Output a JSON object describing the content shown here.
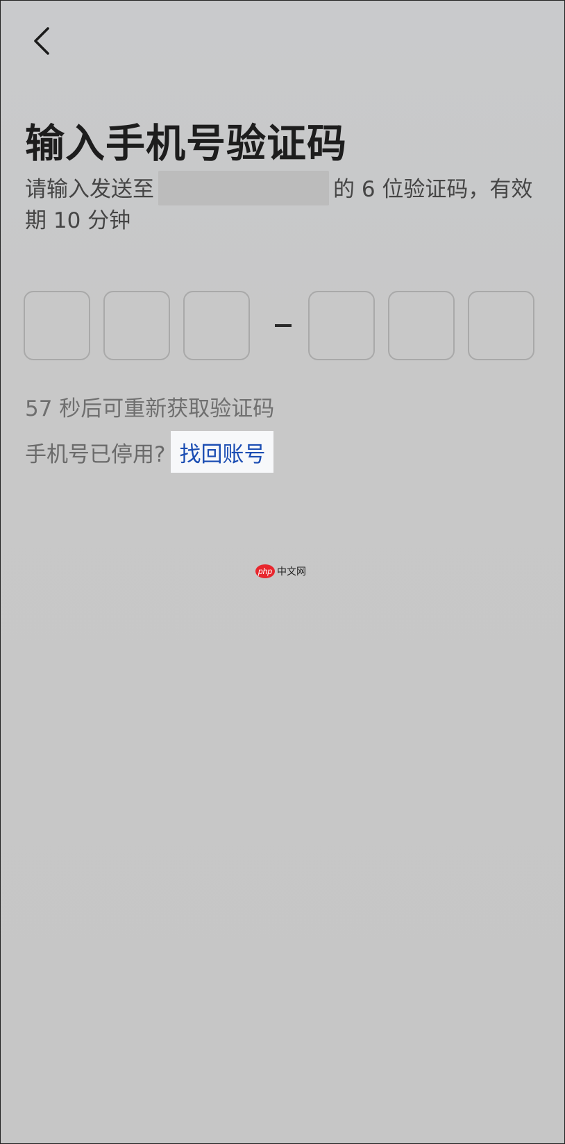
{
  "header": {
    "back_icon": "chevron-left-icon"
  },
  "title": "输入手机号验证码",
  "description": {
    "before_mask": "请输入发送至",
    "after_mask": "的 6 位验证码，有效期 10 分钟"
  },
  "code_input": {
    "digits": [
      "",
      "",
      "",
      "",
      "",
      ""
    ],
    "separator": "-"
  },
  "countdown_text": "57 秒后可重新获取验证码",
  "disabled_phone": {
    "prompt": "手机号已停用?",
    "link_label": "找回账号"
  },
  "watermark": {
    "logo_text": "php",
    "text": "中文网"
  },
  "colors": {
    "link": "#1b4db3",
    "watermark_logo": "#e8262d"
  }
}
